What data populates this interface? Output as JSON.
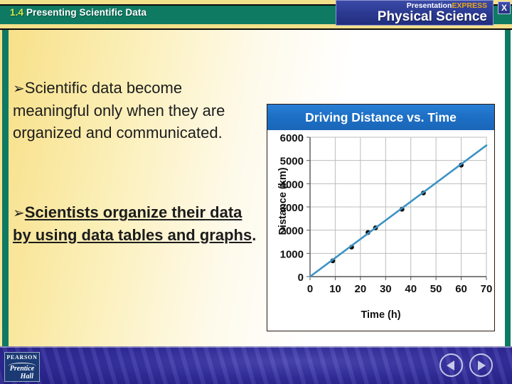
{
  "header": {
    "section_number": "1.4",
    "section_title": "Presenting Scientific Data",
    "brand_line1_a": "Presentation",
    "brand_line1_b": "EXPRESS",
    "brand_line2": "Physical Science",
    "close_label": "X"
  },
  "body": {
    "bullet_marker": "➢",
    "bullet1_text": "Scientific data become meaningful only when they are organized and communicated.",
    "bullet2_text": "Scientists organize their data by using data tables and graphs",
    "bullet2_period": "."
  },
  "footer": {
    "logo_top": "PEARSON",
    "logo_mid": "Prentice",
    "logo_bottom": "Hall",
    "prev_label": "Previous slide",
    "next_label": "Next slide"
  },
  "colors": {
    "banner_teal": "#0f7a62",
    "banner_yellow": "#f2e08a",
    "section_number": "#d6e84a",
    "brand_blue": "#2c3a92",
    "brand_express_gold": "#e9a81c",
    "chart_title_blue": "#1d70c6",
    "series_line": "#3b93c4",
    "marker": "#111111",
    "grid": "#bdbdbd",
    "footer_blue": "#312c9b"
  },
  "chart_data": {
    "type": "scatter",
    "title": "Driving Distance vs. Time",
    "xlabel": "Time (h)",
    "ylabel": "Distance (km)",
    "xlim": [
      0,
      70
    ],
    "ylim": [
      0,
      6000
    ],
    "xticks": [
      0,
      10,
      20,
      30,
      40,
      50,
      60,
      70
    ],
    "yticks": [
      0,
      1000,
      2000,
      3000,
      4000,
      5000,
      6000
    ],
    "grid": true,
    "legend": null,
    "series": [
      {
        "name": "Driving distance",
        "marker": "filled-circle",
        "x": [
          9,
          16.5,
          23,
          26,
          36.5,
          45,
          60
        ],
        "y": [
          680,
          1270,
          1900,
          2100,
          2900,
          3600,
          4800
        ]
      },
      {
        "name": "Best-fit line",
        "marker": "none",
        "line_through": [
          [
            0,
            0
          ],
          [
            70,
            5650
          ]
        ],
        "slope_km_per_h": 80.7
      }
    ]
  }
}
